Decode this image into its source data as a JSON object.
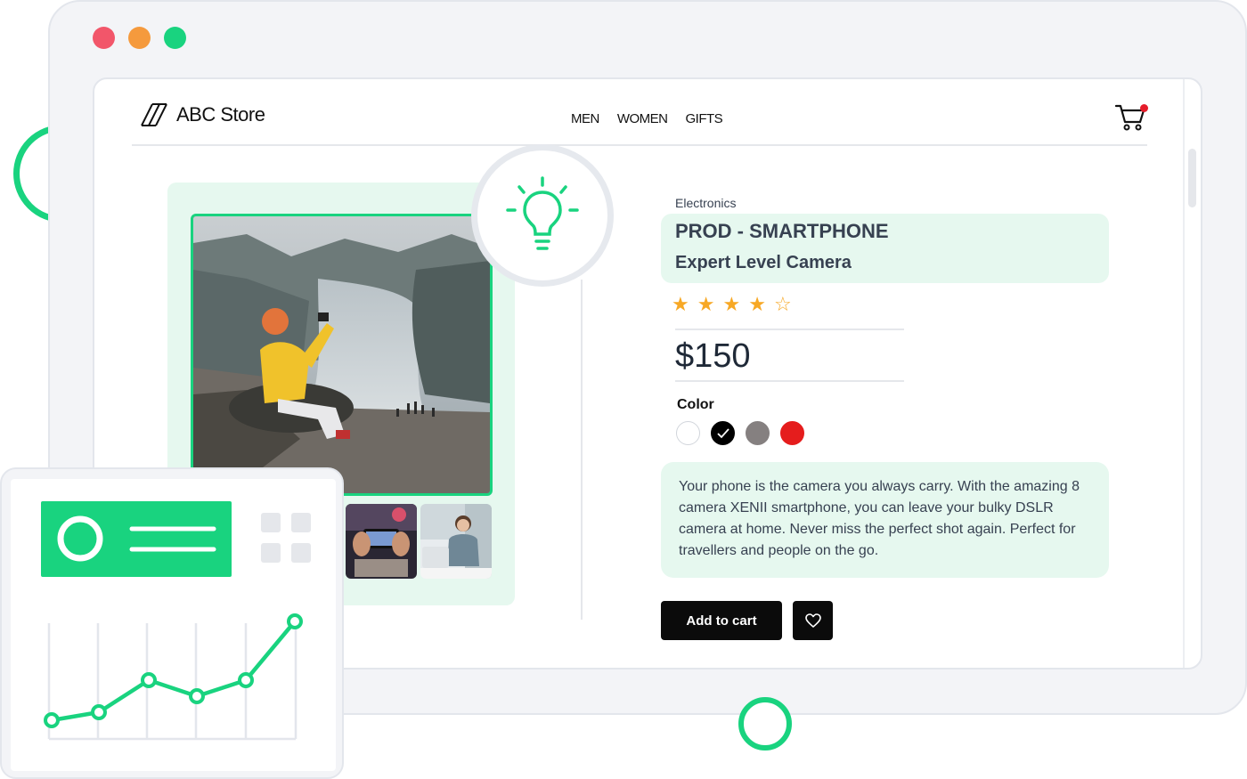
{
  "store": {
    "name": "ABC Store"
  },
  "nav": {
    "items": [
      "MEN",
      "WOMEN",
      "GIFTS"
    ]
  },
  "product": {
    "category": "Electronics",
    "title": "PROD - SMARTPHONE",
    "subtitle": "Expert Level Camera",
    "rating": 4,
    "rating_max": 5,
    "price": "$150",
    "color_label": "Color",
    "colors": [
      "#ffffff",
      "#000000",
      "#858080",
      "#e51d1d"
    ],
    "selected_color": 1,
    "description": "Your phone is the camera you always carry. With the amazing 8 camera XENII smartphone, you can leave your bulky DSLR camera at home. Never miss the perfect shot again. Perfect for travellers and people on the go.",
    "add_to_cart_label": "Add to cart"
  },
  "theme": {
    "accent": "#19d37f",
    "star": "#f7a825",
    "badge": "#e51d2a"
  },
  "icons": [
    "logo-icon",
    "cart-icon",
    "lightbulb-icon",
    "heart-icon",
    "check-icon",
    "star-icon"
  ]
}
